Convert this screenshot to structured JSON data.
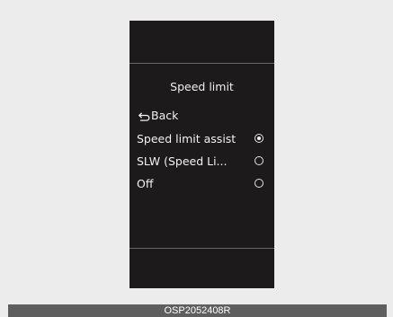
{
  "screen": {
    "title": "Speed limit",
    "items": [
      {
        "label": "Back",
        "icon": "return-arrow-icon",
        "has_radio": false
      },
      {
        "label": "Speed limit assist",
        "has_radio": true,
        "selected": true
      },
      {
        "label": "SLW (Speed Li...",
        "has_radio": true,
        "selected": false
      },
      {
        "label": "Off",
        "has_radio": true,
        "selected": false
      }
    ]
  },
  "caption": "OSP2052408R"
}
